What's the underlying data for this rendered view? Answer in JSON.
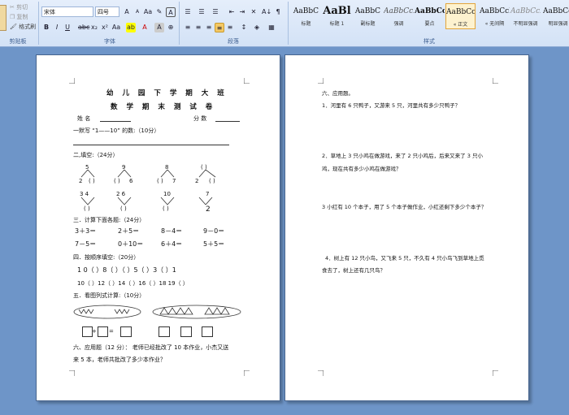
{
  "ribbon": {
    "clipboard": {
      "cut": "剪切",
      "copy": "复制",
      "paste": "粘贴",
      "format_painter": "格式刷",
      "group": "剪贴板"
    },
    "font": {
      "name": "宋体",
      "size": "四号",
      "group": "字体"
    },
    "paragraph": {
      "group": "段落"
    },
    "styles": {
      "group": "样式",
      "items": [
        {
          "preview": "AaBbC",
          "name": "标题"
        },
        {
          "preview": "AaBl",
          "name": "标题 1"
        },
        {
          "preview": "AaBbC",
          "name": "副标题"
        },
        {
          "preview": "AaBbCcD",
          "name": "强调"
        },
        {
          "preview": "AaBbCcD",
          "name": "要点"
        },
        {
          "preview": "AaBbCcDc",
          "name": "« 正文"
        },
        {
          "preview": "AaBbCcDc",
          "name": "« 无间隔"
        },
        {
          "preview": "AaBbCcDc",
          "name": "不明显强调"
        },
        {
          "preview": "AaBbCcDc",
          "name": "明显强调"
        }
      ]
    }
  },
  "page1": {
    "title1": "幼 儿 园 下 学 期 大 班",
    "title2": "数 学 期 末 测 试 卷",
    "name_label": "姓 名",
    "score_label": "分 数",
    "s1": "一默写 “1——10” 的数:（10分）",
    "s2": "二,填空:（24分）",
    "fill_top": [
      "5",
      "9",
      "8",
      "(  )"
    ],
    "fill_bot1": [
      "2",
      "(  )",
      "(  )",
      "6",
      "(  )",
      "7",
      "2",
      "(  )"
    ],
    "fill_top2": [
      "3   4",
      "2   6",
      "10",
      "7"
    ],
    "fill_bot2": [
      "(  )",
      "(  )",
      "(  )",
      "2"
    ],
    "s3": "三．计算下面各题:（24分）",
    "calc_row1": [
      "3＋3＝",
      "2＋5＝",
      "8－4＝",
      "9－0＝"
    ],
    "calc_row2": [
      "7－5＝",
      "0＋10＝",
      "6＋4＝",
      "5＋5＝"
    ],
    "s4": "四．按顺序填空:（20分）",
    "seq_row1": "1 0（   ）8（   ）（   ）5（   ）3（   ）1",
    "seq_row2": "10（   ）12（   ）14（   ）16（   ）18   19（   ）",
    "s5": "五．看图列式计算:（10分）",
    "plus": "+",
    "eq": "=",
    "s6_line1": "六、应用题（12 分）：   老师已经批改了 10 本作业，小杰又送",
    "s6_line2": "来 5 本，老师共批改了多少本作业？"
  },
  "page2": {
    "heading": "六、应用题。",
    "q1": "1．河里有 6 只鸭子，又游来 5 只，河里共有多少只鸭子？",
    "q2a": "2．草地上 3 只小鸡在做游戏，来了 2 只小鸡后，后来又来了 3 只小",
    "q2b": "鸡，现在共有多少小鸡在做游戏？",
    "q3": "3 小红有 10 个本子，用了 5 个本子做作业，小红还剩下多少个本子？",
    "q4a": "4．树上有 12 只小鸟，又飞来 5 只，不久有 4 只小鸟飞到草地上觅",
    "q4b": "食去了，树上还有几只鸟？"
  }
}
